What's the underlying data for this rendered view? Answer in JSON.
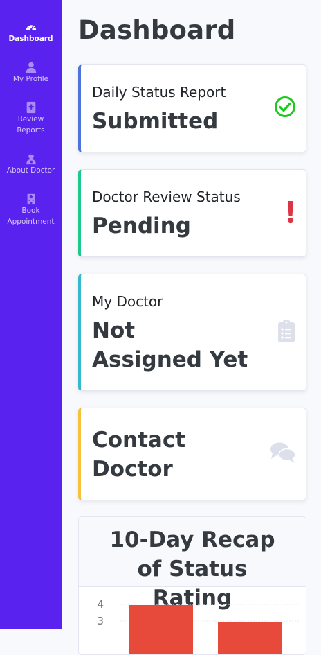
{
  "sidebar": {
    "items": [
      {
        "label": "Dashboard",
        "icon": "dashboard-gauge-icon",
        "active": true
      },
      {
        "label": "My Profile",
        "icon": "user-icon",
        "active": false
      },
      {
        "label": "Review Reports",
        "icon": "medical-file-icon",
        "active": false
      },
      {
        "label": "About Doctor",
        "icon": "doctor-icon",
        "active": false
      },
      {
        "label": "Book Appointment",
        "icon": "hospital-icon",
        "active": false
      }
    ]
  },
  "header": {
    "title": "Dashboard"
  },
  "cards": [
    {
      "label": "Daily Status Report",
      "value": "Submitted",
      "icon": "check-circle-icon",
      "accent": "#4e73df",
      "icon_color": "#1ec91e"
    },
    {
      "label": "Doctor Review Status",
      "value": "Pending",
      "icon": "exclamation-icon",
      "accent": "#1cc88a",
      "icon_color": "#dc3545"
    },
    {
      "label": "My Doctor",
      "value": "Not Assigned Yet",
      "icon": "clipboard-list-icon",
      "accent": "#36b9cc",
      "icon_color": "#dddfeb"
    },
    {
      "label": "",
      "value": "Contact Doctor",
      "icon": "comments-icon",
      "accent": "#f6c23e",
      "icon_color": "#dddfeb"
    }
  ],
  "chart": {
    "title": "10-Day Recap of Status Rating"
  },
  "chart_data": {
    "type": "bar",
    "title": "10-Day Recap of Status Rating",
    "categories": [
      "",
      ""
    ],
    "values": [
      4,
      3
    ],
    "ylim": [
      0,
      4
    ],
    "ytick_labels": [
      "4",
      "3"
    ],
    "bar_color": "#e74a3b",
    "grid": true
  }
}
